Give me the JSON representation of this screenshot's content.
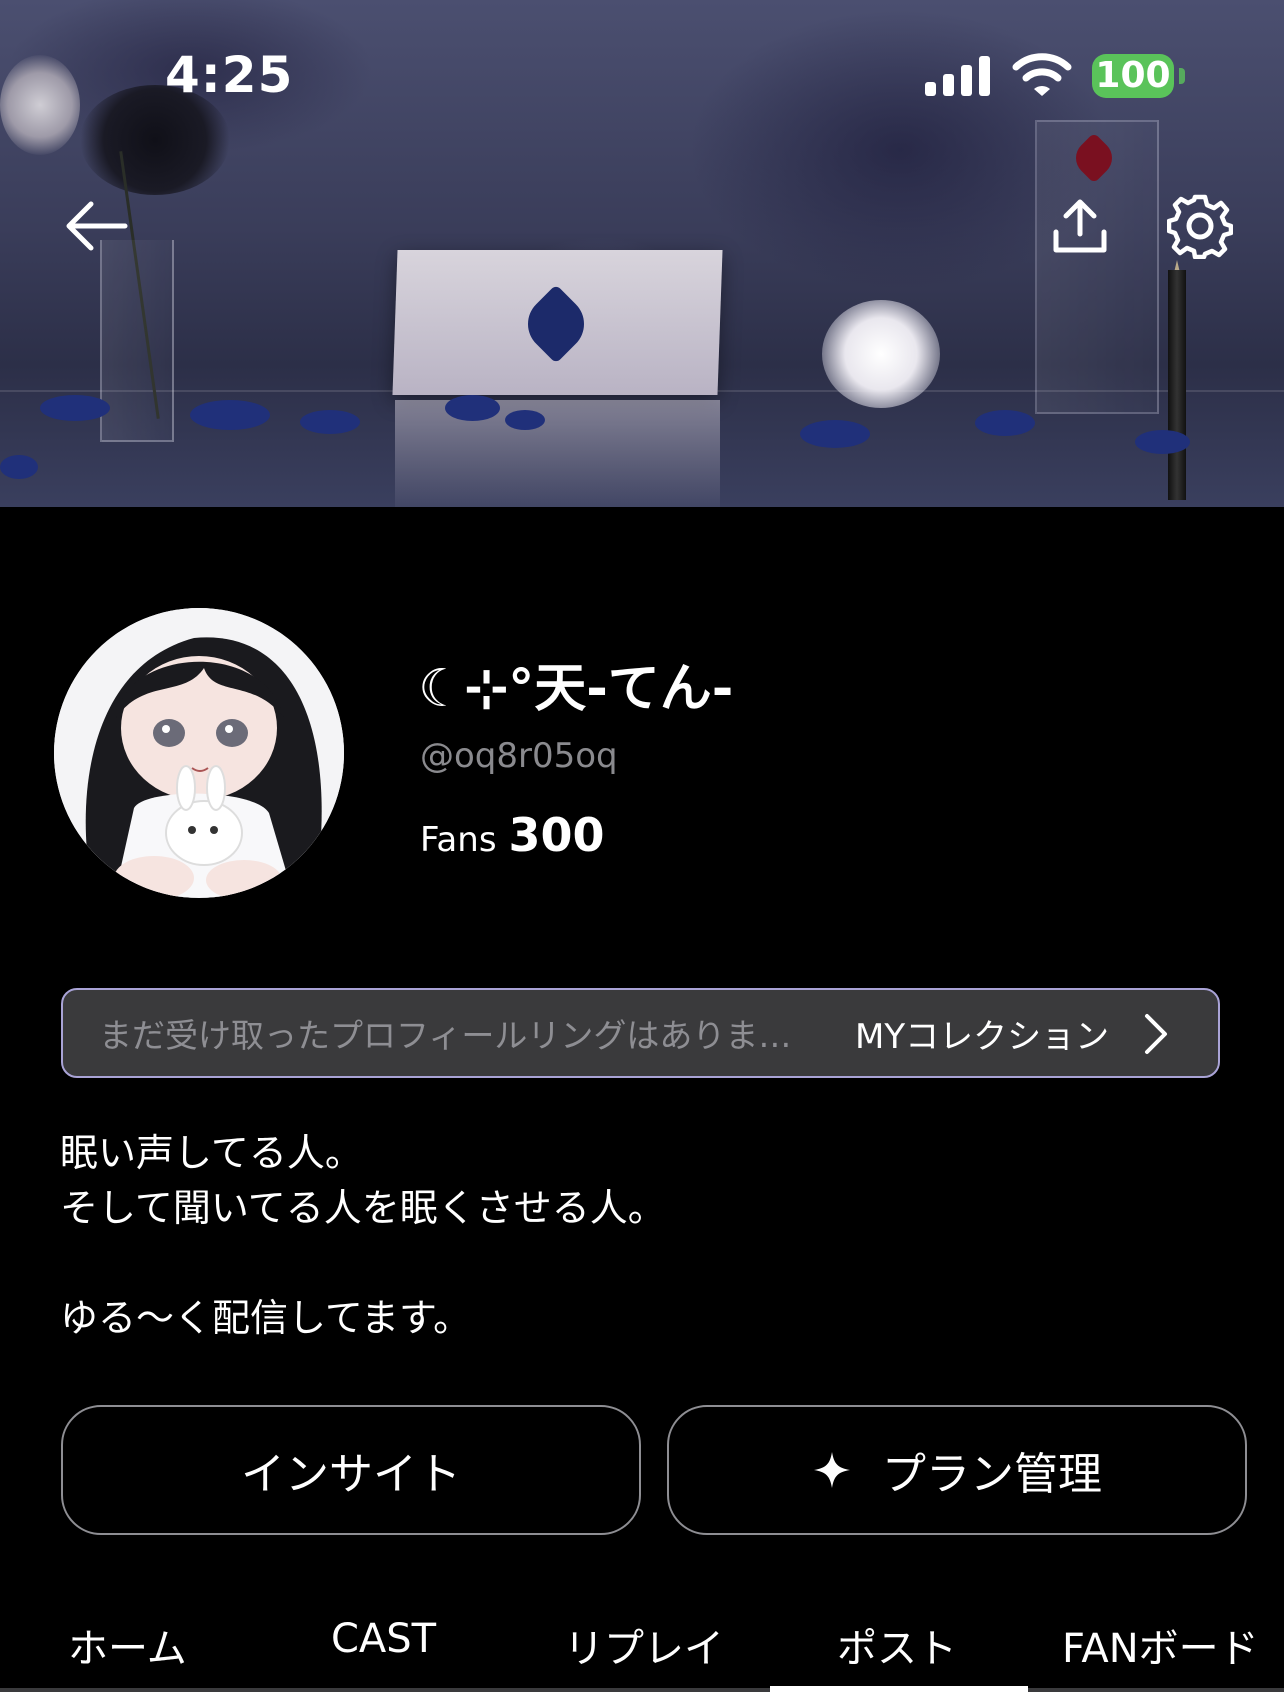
{
  "status_bar": {
    "time": "4:25",
    "battery": "100",
    "icons": [
      "cellular-signal-icon",
      "wifi-icon",
      "battery-icon"
    ],
    "battery_color": "#5ac35a"
  },
  "header": {
    "back_icon": "arrow-left-icon",
    "share_icon": "share-upload-icon",
    "settings_icon": "gear-icon"
  },
  "profile": {
    "name": "☾⊹°天-てん-",
    "handle": "@oq8r05oq",
    "fans_label": "Fans",
    "fans_count": "300"
  },
  "ring_collection": {
    "placeholder": "まだ受け取ったプロフィールリングはありま…",
    "link_label": "MYコレクション",
    "border_color": "#a9a3d6"
  },
  "bio": {
    "lines": [
      "眠い声してる人。",
      "そして聞いてる人を眠くさせる人。",
      "",
      "ゆる〜く配信してます。"
    ]
  },
  "actions": {
    "insight_label": "インサイト",
    "plan_label": "プラン管理",
    "plan_icon": "sparkle-icon"
  },
  "tabs": {
    "items": [
      {
        "label": "ホーム"
      },
      {
        "label": "CAST"
      },
      {
        "label": "リプレイ"
      },
      {
        "label": "ポスト"
      },
      {
        "label": "FANボード"
      }
    ],
    "active": "ポスト"
  }
}
